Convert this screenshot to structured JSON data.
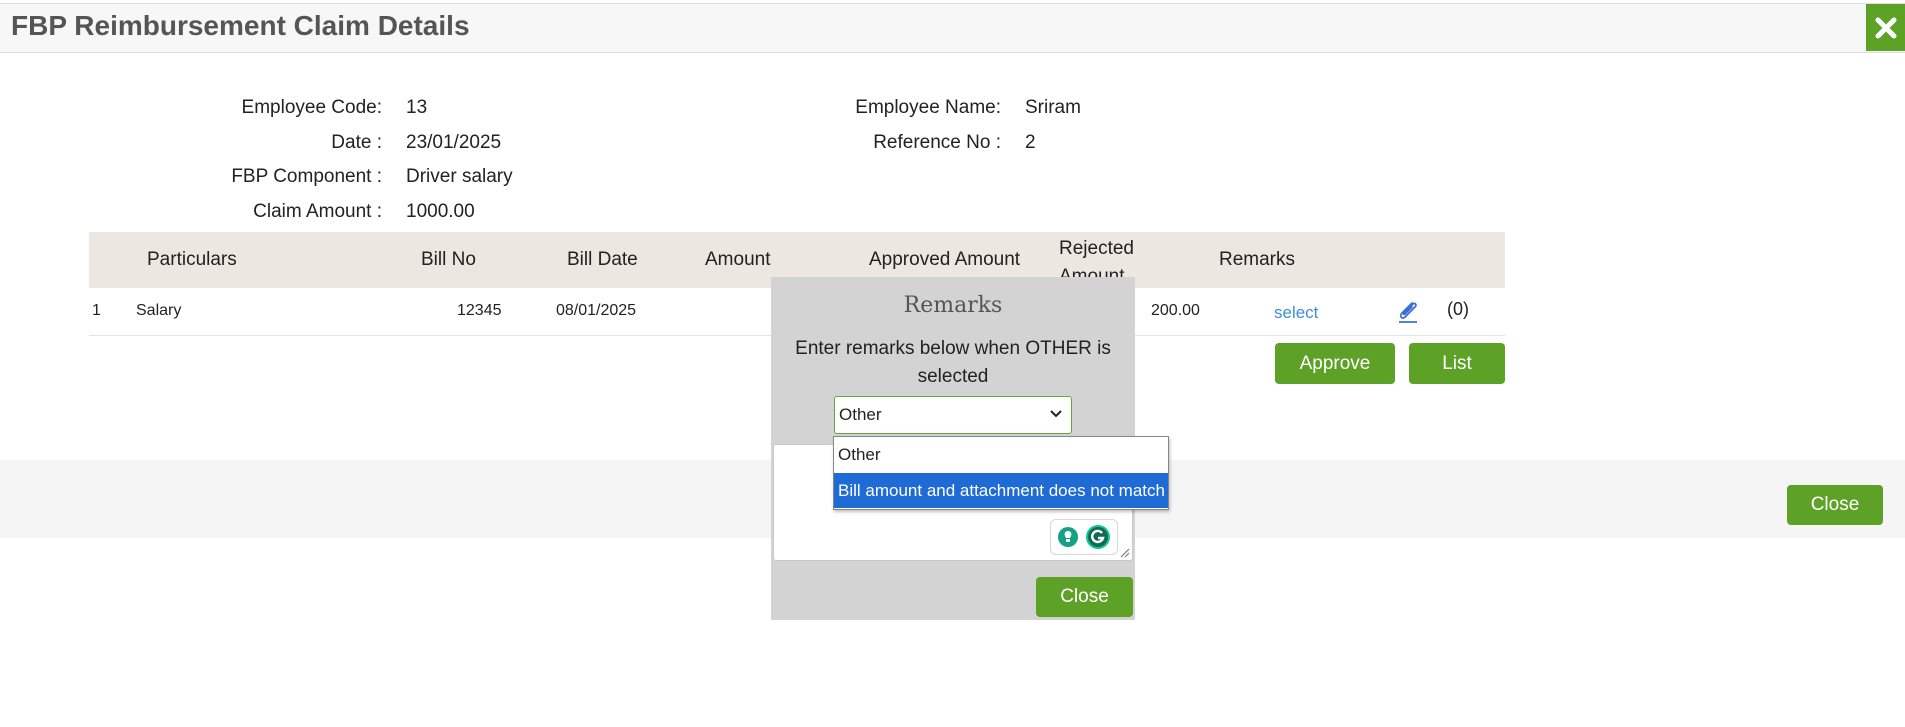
{
  "header": {
    "title": "FBP Reimbursement Claim Details",
    "close_icon": "x-icon"
  },
  "details": {
    "employee_code_label": "Employee Code:",
    "employee_code": "13",
    "employee_name_label": "Employee Name:",
    "employee_name": "Sriram",
    "date_label": "Date :",
    "date": "23/01/2025",
    "reference_label": "Reference No :",
    "reference": "2",
    "component_label": "FBP Component :",
    "component": "Driver salary",
    "claim_amount_label": "Claim Amount :",
    "claim_amount": "1000.00"
  },
  "table": {
    "headers": {
      "particulars": "Particulars",
      "bill_no": "Bill No",
      "bill_date": "Bill Date",
      "amount": "Amount",
      "approved_amount": "Approved Amount",
      "rejected_amount": "Rejected Amount",
      "remarks": "Remarks"
    },
    "rows": [
      {
        "index": "1",
        "particulars": "Salary",
        "bill_no": "12345",
        "bill_date": "08/01/2025",
        "rejected_amount": "200.00",
        "remarks_link": "select",
        "attachment_count": "(0)"
      }
    ]
  },
  "actions": {
    "approve": "Approve",
    "list": "List",
    "close": "Close"
  },
  "modal": {
    "title": "Remarks",
    "instruction": "Enter remarks below when OTHER is selected",
    "selected_value": "Other",
    "options": [
      "Other",
      "Bill amount and attachment does not match"
    ],
    "highlighted_option": "Bill amount and attachment does not match",
    "close": "Close"
  },
  "colors": {
    "accent": "#5da126",
    "link": "#3b8fd9",
    "highlight": "#1e6bd6",
    "table_header": "#ede7e1"
  }
}
